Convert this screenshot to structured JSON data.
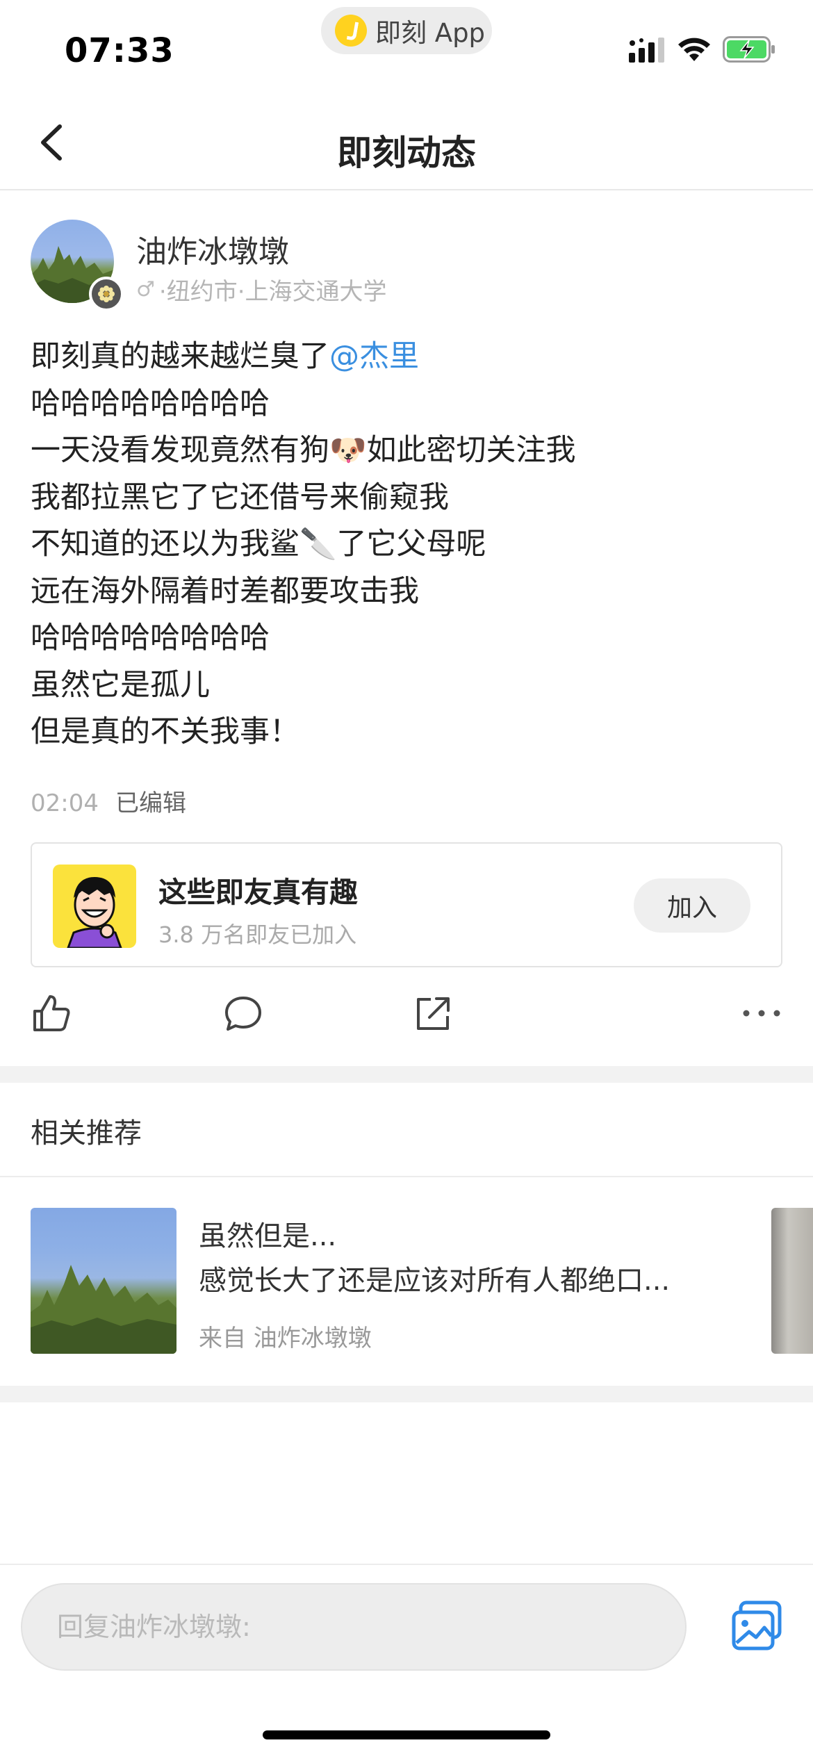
{
  "status_bar": {
    "time": "07:33",
    "app_pill": "即刻 App",
    "icons": [
      "signal-icon",
      "wifi-icon",
      "battery-charging-icon"
    ]
  },
  "nav": {
    "title": "即刻动态",
    "back_icon": "chevron-left-icon"
  },
  "post": {
    "author": {
      "name": "油炸冰墩墩",
      "gender_symbol": "♂",
      "meta": "·纽约市·上海交通大学"
    },
    "body_lines": [
      "即刻真的越来越烂臭了",
      "哈哈哈哈哈哈哈哈",
      "一天没看发现竟然有狗🐶如此密切关注我",
      "我都拉黑它了它还借号来偷窥我",
      "不知道的还以为我鲨🔪了它父母呢",
      "远在海外隔着时差都要攻击我",
      "哈哈哈哈哈哈哈哈",
      "虽然它是孤儿",
      "但是真的不关我事！"
    ],
    "mention": "@杰里",
    "time": "02:04",
    "edited": "已编辑"
  },
  "topic_card": {
    "title": "这些即友真有趣",
    "subtitle": "3.8 万名即友已加入",
    "join_label": "加入"
  },
  "actions": [
    "like-icon",
    "comment-icon",
    "share-icon",
    "more-icon"
  ],
  "related": {
    "header": "相关推荐",
    "items": [
      {
        "title": "虽然但是...",
        "desc": "感觉长大了还是应该对所有人都绝口...",
        "source": "来自 油炸冰墩墩"
      }
    ]
  },
  "reply": {
    "placeholder": "回复油炸冰墩墩:",
    "image_icon": "image-icon"
  },
  "colors": {
    "mention": "#3a8fe0",
    "battery": "#4cd964",
    "accent_icon": "#2f8ae8",
    "topic_bg": "#fbe23c"
  }
}
